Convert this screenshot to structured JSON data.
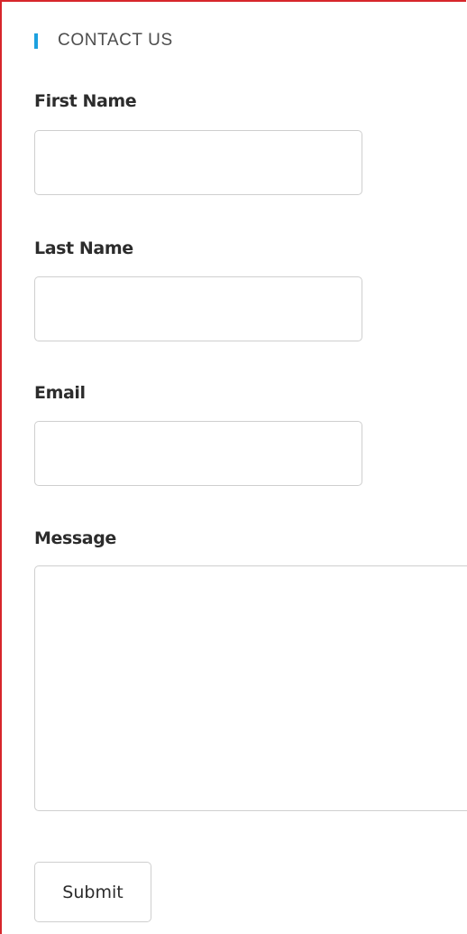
{
  "header": {
    "title": "CONTACT US",
    "accent_color": "#1da1df"
  },
  "form": {
    "first_name": {
      "label": "First Name",
      "value": "",
      "placeholder": ""
    },
    "last_name": {
      "label": "Last Name",
      "value": "",
      "placeholder": ""
    },
    "email": {
      "label": "Email",
      "value": "",
      "placeholder": ""
    },
    "message": {
      "label": "Message",
      "value": "",
      "placeholder": ""
    },
    "submit_label": "Submit"
  },
  "colors": {
    "frame_border": "#d7262b",
    "field_border": "#cfcfcf",
    "label_text": "#2c2c2c"
  }
}
